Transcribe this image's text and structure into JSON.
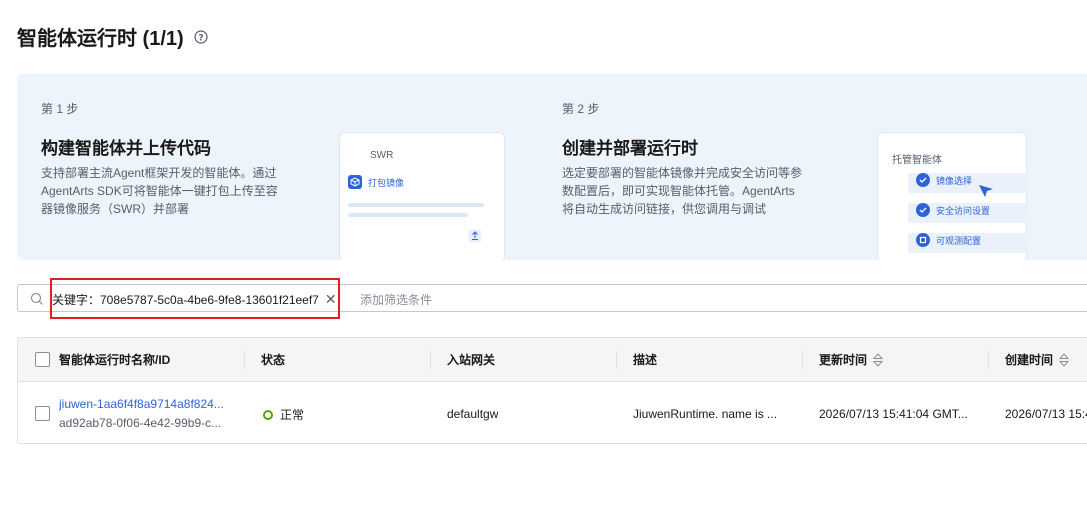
{
  "page": {
    "title": "智能体运行时 (1/1)"
  },
  "steps": [
    {
      "number": "第 1 步",
      "title": "构建智能体并上传代码",
      "description": "支持部署主流Agent框架开发的智能体。通过AgentArts SDK可将智能体一键打包上传至容器镜像服务（SWR）并部署",
      "card": {
        "label": "SWR",
        "chip": "打包镜像"
      }
    },
    {
      "number": "第 2 步",
      "title": "创建并部署运行时",
      "description": "选定要部署的智能体镜像并完成安全访问等参数配置后，即可实现智能体托管。AgentArts将自动生成访问链接，供您调用与调试",
      "card": {
        "label": "托管智能体",
        "items": [
          "镜像选择",
          "安全访问设置",
          "可观测配置"
        ]
      }
    }
  ],
  "filter": {
    "tag": "关键字：708e5787-5c0a-4be6-9fe8-13601f21eef7",
    "add_placeholder": "添加筛选条件"
  },
  "table": {
    "columns": [
      "智能体运行时名称/ID",
      "状态",
      "入站网关",
      "描述",
      "更新时间",
      "创建时间"
    ],
    "rows": [
      {
        "name": "jiuwen-1aa6f4f8a9714a8f824...",
        "id": "ad92ab78-0f06-4e42-99b9-c...",
        "status": "正常",
        "gateway": "defaultgw",
        "description": "JiuwenRuntime. name is ...",
        "updated": "2026/07/13 15:41:04 GMT...",
        "created": "2026/07/13 15:4"
      }
    ]
  },
  "colors": {
    "accent": "#2e63d8",
    "status_ok": "#50a800",
    "highlight": "#e02020"
  }
}
